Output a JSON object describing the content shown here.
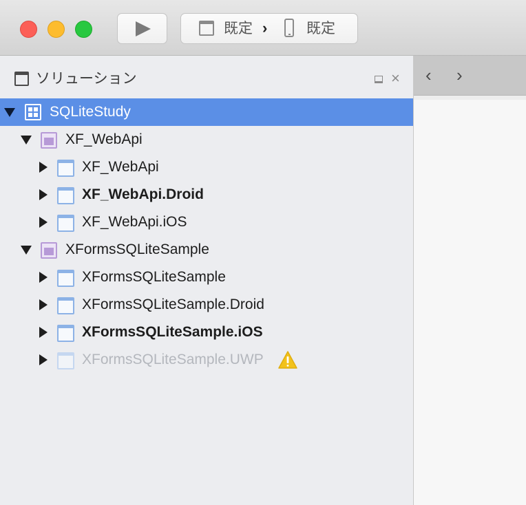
{
  "toolbar": {
    "run_button_label": "Run",
    "config_left": "既定",
    "config_separator": "›",
    "config_right": "既定"
  },
  "solution_pane": {
    "title": "ソリューション",
    "close_glyph": "×"
  },
  "tree": {
    "solution": "SQLiteStudy",
    "folders": [
      {
        "label": "XF_WebApi",
        "projects": [
          {
            "label": "XF_WebApi",
            "bold": false,
            "dim": false
          },
          {
            "label": "XF_WebApi.Droid",
            "bold": true,
            "dim": false
          },
          {
            "label": "XF_WebApi.iOS",
            "bold": false,
            "dim": false
          }
        ]
      },
      {
        "label": "XFormsSQLiteSample",
        "projects": [
          {
            "label": "XFormsSQLiteSample",
            "bold": false,
            "dim": false
          },
          {
            "label": "XFormsSQLiteSample.Droid",
            "bold": false,
            "dim": false
          },
          {
            "label": "XFormsSQLiteSample.iOS",
            "bold": true,
            "dim": false
          },
          {
            "label": "XFormsSQLiteSample.UWP",
            "bold": false,
            "dim": true,
            "warning": true
          }
        ]
      }
    ]
  },
  "nav": {
    "back_glyph": "‹",
    "forward_glyph": "›"
  },
  "colors": {
    "selection": "#5b8fe6",
    "warning": "#f2c21c",
    "folder_icon": "#b79ad7",
    "project_icon": "#8cb2e6"
  }
}
